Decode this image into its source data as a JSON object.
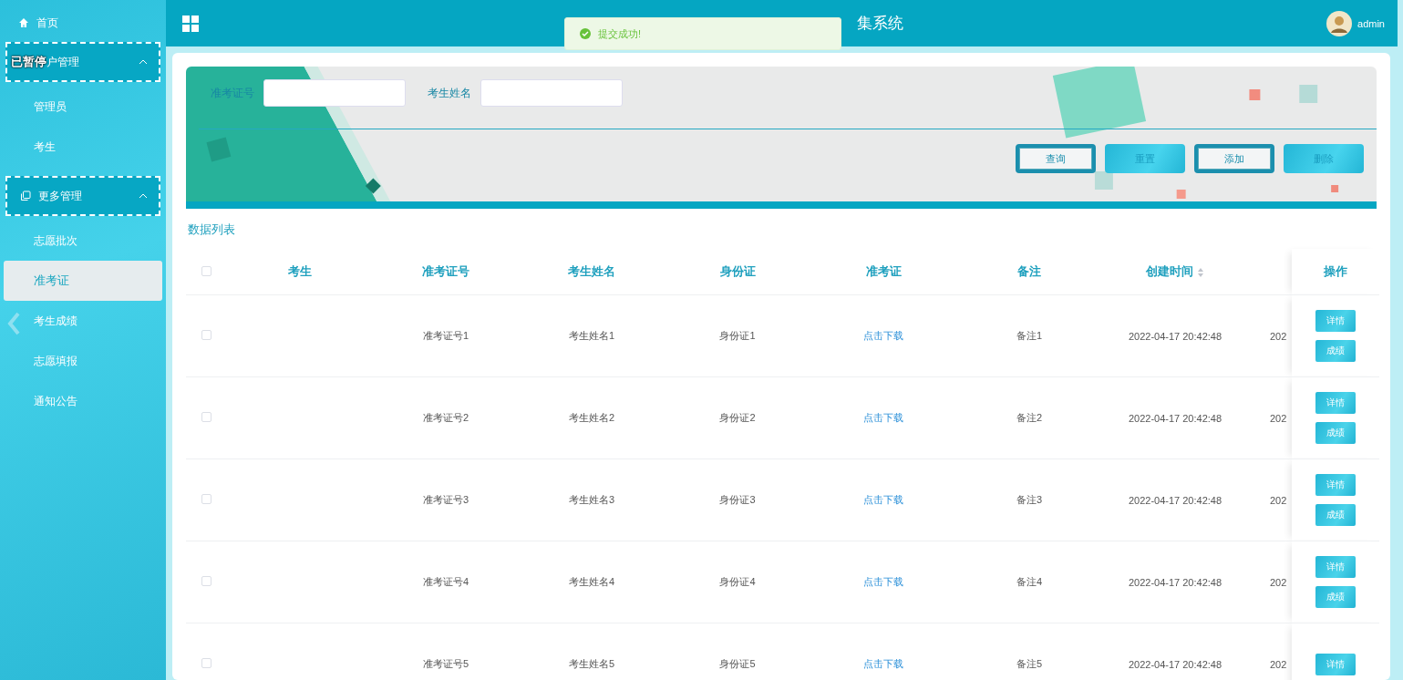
{
  "sidebar": {
    "items": [
      {
        "kind": "link",
        "label": "首页",
        "selected": false
      },
      {
        "kind": "group",
        "label": "户管理",
        "expanded": true,
        "children": [
          {
            "label": "管理员",
            "selected": false
          },
          {
            "label": "考生",
            "selected": false
          }
        ]
      },
      {
        "kind": "group",
        "label": "更多管理",
        "expanded": true,
        "children": [
          {
            "label": "志愿批次",
            "selected": false
          },
          {
            "label": "准考证",
            "selected": true
          },
          {
            "label": "考生成绩",
            "selected": false
          },
          {
            "label": "志愿填报",
            "selected": false
          },
          {
            "label": "通知公告",
            "selected": false
          }
        ]
      }
    ]
  },
  "overlay_text": "已暂停",
  "header": {
    "title": "集系统",
    "user": "admin"
  },
  "toast": {
    "message": "提交成功!"
  },
  "search": {
    "fields": [
      {
        "label": "准考证号"
      },
      {
        "label": "考生姓名"
      }
    ],
    "buttons": [
      {
        "label": "查询",
        "kind": "outline"
      },
      {
        "label": "重置",
        "kind": "filled"
      },
      {
        "label": "添加",
        "kind": "outline"
      },
      {
        "label": "删除",
        "kind": "filled"
      }
    ]
  },
  "list_title": "数据列表",
  "table": {
    "all_checked": false,
    "columns": [
      "考生",
      "准考证号",
      "考生姓名",
      "身份证",
      "准考证",
      "备注",
      "创建时间",
      "",
      "操作"
    ],
    "rows": [
      {
        "checked": false,
        "cells": [
          "",
          "准考证号1",
          "考生姓名1",
          "身份证1",
          "点击下载",
          "备注1",
          "2022-04-17 20:42:48",
          "202"
        ],
        "actions": [
          "详情",
          "成绩"
        ]
      },
      {
        "checked": false,
        "cells": [
          "",
          "准考证号2",
          "考生姓名2",
          "身份证2",
          "点击下载",
          "备注2",
          "2022-04-17 20:42:48",
          "202"
        ],
        "actions": [
          "详情",
          "成绩"
        ]
      },
      {
        "checked": false,
        "cells": [
          "",
          "准考证号3",
          "考生姓名3",
          "身份证3",
          "点击下载",
          "备注3",
          "2022-04-17 20:42:48",
          "202"
        ],
        "actions": [
          "详情",
          "成绩"
        ]
      },
      {
        "checked": false,
        "cells": [
          "",
          "准考证号4",
          "考生姓名4",
          "身份证4",
          "点击下载",
          "备注4",
          "2022-04-17 20:42:48",
          "202"
        ],
        "actions": [
          "详情",
          "成绩"
        ]
      },
      {
        "checked": false,
        "cells": [
          "",
          "准考证号5",
          "考生姓名5",
          "身份证5",
          "点击下载",
          "备注5",
          "2022-04-17 20:42:48",
          "202"
        ],
        "actions": [
          "详情"
        ]
      }
    ]
  }
}
